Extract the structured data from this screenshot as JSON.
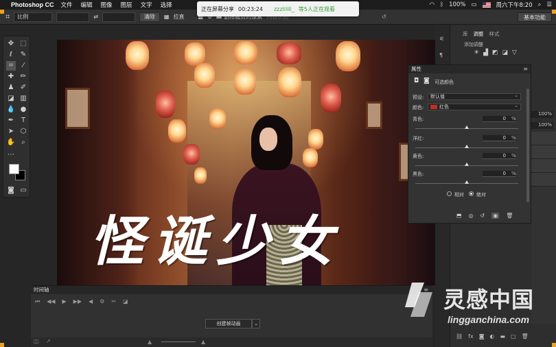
{
  "menubar": {
    "app": "Photoshop CC",
    "items": [
      "文件",
      "编辑",
      "图像",
      "图层",
      "文字",
      "选择"
    ],
    "battery": "100%",
    "clock": "周六下午8:20"
  },
  "share_banner": {
    "status": "正在屏幕分享",
    "time": "00:23:24",
    "user": "zzzlilili_",
    "viewers": "等5人正在观看"
  },
  "options_bar": {
    "ratio": "比例",
    "clear": "清除",
    "straighten": "拉直",
    "delete_cropped": "删除裁剪的像素",
    "content_aware": "内容识别",
    "workspace": "基本功能"
  },
  "canvas": {
    "title_text": "怪诞少女"
  },
  "right_panel": {
    "tabs": [
      "库",
      "调整",
      "样式"
    ],
    "add_adjustment": "添加调整",
    "opacity_1": "100%",
    "opacity_2": "100%"
  },
  "properties": {
    "title": "属性",
    "layer_type": "可选颜色",
    "preset_label": "预设:",
    "preset_value": "默认值",
    "color_label": "颜色:",
    "color_value": "红色",
    "sliders": [
      {
        "label": "青色:",
        "value": "0",
        "unit": "%"
      },
      {
        "label": "洋红:",
        "value": "0",
        "unit": "%"
      },
      {
        "label": "黄色:",
        "value": "0",
        "unit": "%"
      },
      {
        "label": "黑色:",
        "value": "0",
        "unit": "%"
      }
    ],
    "relative": "相对",
    "absolute": "绝对",
    "mode_selected": "absolute"
  },
  "timeline": {
    "title": "时间轴",
    "create_button": "创建帧动画"
  },
  "watermark": {
    "cn": "灵感中国",
    "en": "lingganchina.com"
  },
  "colors": {
    "accent_red": "#c03020",
    "share_green": "#3a9a3a",
    "corner_orange": "#f0a020"
  }
}
